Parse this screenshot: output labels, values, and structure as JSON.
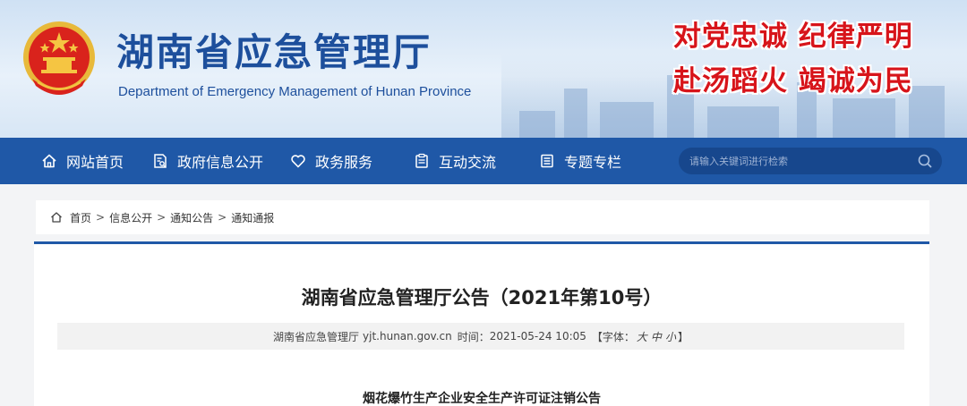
{
  "header": {
    "site_title": "湖南省应急管理厅",
    "site_subtitle": "Department of Emergency Management of Hunan Province",
    "slogan_line1": "对党忠诚  纪律严明",
    "slogan_line2": "赴汤蹈火  竭诚为民"
  },
  "nav": {
    "items": [
      {
        "label": "网站首页",
        "icon": "home-icon"
      },
      {
        "label": "政府信息公开",
        "icon": "document-search-icon"
      },
      {
        "label": "政务服务",
        "icon": "heart-icon"
      },
      {
        "label": "互动交流",
        "icon": "clipboard-icon"
      },
      {
        "label": "专题专栏",
        "icon": "list-document-icon"
      }
    ],
    "search_placeholder": "请输入关键词进行检索"
  },
  "breadcrumb": {
    "items": [
      "首页",
      "信息公开",
      "通知公告",
      "通知通报"
    ],
    "separator": ">"
  },
  "article": {
    "title": "湖南省应急管理厅公告（2021年第10号）",
    "source": "湖南省应急管理厅",
    "site": "yjt.hunan.gov.cn",
    "time_label": "时间：",
    "time": "2021-05-24 10:05",
    "font_open": "【字体：",
    "font_large": "大",
    "font_medium": "中",
    "font_small": "小",
    "font_close": "】",
    "subheading": "烟花爆竹生产企业安全生产许可证注销公告"
  },
  "colors": {
    "brand_blue": "#1f58a7",
    "slogan_red": "#d7141a",
    "title_blue": "#1d4f9c"
  }
}
